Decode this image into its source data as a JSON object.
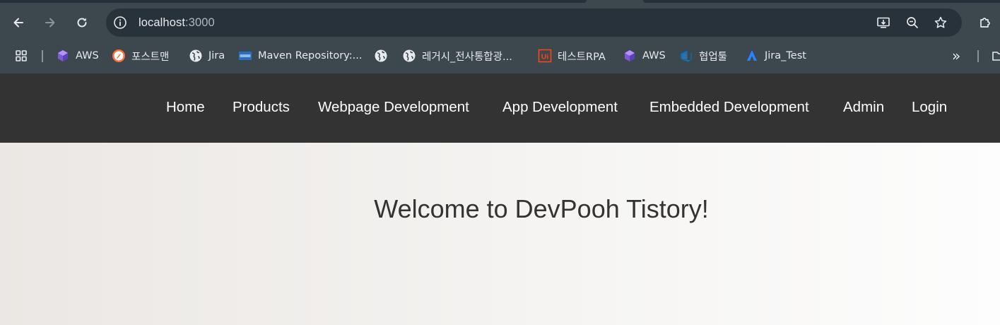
{
  "browser": {
    "url_host": "localhost",
    "url_port": ":3000",
    "icons": {
      "back": "arrow-left-icon",
      "forward": "arrow-right-icon",
      "reload": "reload-icon",
      "site_info": "info-icon",
      "install": "install-app-icon",
      "zoom": "zoom-icon",
      "bookmark_star": "star-icon",
      "extensions": "puzzle-icon"
    }
  },
  "bookmarks": {
    "items": [
      {
        "label": "AWS",
        "icon": "aws-cube-icon"
      },
      {
        "label": "포스트맨",
        "icon": "postman-icon"
      },
      {
        "label": "Jira",
        "icon": "globe-icon"
      },
      {
        "label": "Maven Repository:...",
        "icon": "maven-icon"
      },
      {
        "label": "",
        "icon": "globe-icon"
      },
      {
        "label": "레거시_전사통합광...",
        "icon": "globe-icon"
      },
      {
        "label": "테스트RPA",
        "icon": "uipath-icon"
      },
      {
        "label": "AWS",
        "icon": "aws-cube-icon"
      },
      {
        "label": "협업툴",
        "icon": "azure-devops-icon"
      },
      {
        "label": "Jira_Test",
        "icon": "jira-icon"
      }
    ],
    "more": "»"
  },
  "site": {
    "nav": [
      "Home",
      "Products",
      "Webpage Development",
      "App Development",
      "Embedded Development",
      "Admin",
      "Login"
    ],
    "hero_title": "Welcome to DevPooh Tistory!",
    "colors": {
      "header_bg": "#333333",
      "header_text": "#ffffff",
      "hero_text": "#333333"
    }
  }
}
